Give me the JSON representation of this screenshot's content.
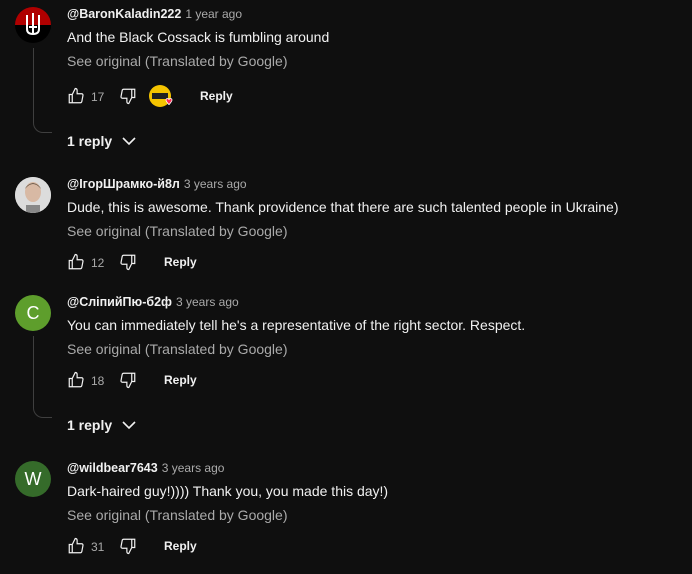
{
  "colors": {
    "background": "#0f0f0f",
    "avatar_c": "#5e9e2c",
    "avatar_w": "#356b2a",
    "heart": "#ff2d55"
  },
  "comments": [
    {
      "author": "@BaronKaladin222",
      "time": "1 year ago",
      "text": "And the Black Cossack is fumbling around",
      "see_original": "See original (Translated by Google)",
      "likes": "17",
      "reply_label": "Reply",
      "replies": "1 reply",
      "avatar": "trident-flag-icon",
      "creator_heart": true
    },
    {
      "author": "@ІгорШрамко-й8л",
      "time": "3 years ago",
      "text": "Dude, this is awesome. Thank providence that there are such talented people in Ukraine)",
      "see_original": "See original (Translated by Google)",
      "likes": "12",
      "reply_label": "Reply",
      "avatar": "photo-avatar"
    },
    {
      "author": "@СліпийПю-б2ф",
      "time": "3 years ago",
      "text": "You can immediately tell he's a representative of the right sector. Respect.",
      "see_original": "See original (Translated by Google)",
      "likes": "18",
      "reply_label": "Reply",
      "replies": "1 reply",
      "avatar_letter": "C"
    },
    {
      "author": "@wildbear7643",
      "time": "3 years ago",
      "text": "Dark-haired guy!)))) Thank you, you made this day!)",
      "see_original": "See original (Translated by Google)",
      "likes": "31",
      "reply_label": "Reply",
      "avatar_letter": "W"
    }
  ]
}
